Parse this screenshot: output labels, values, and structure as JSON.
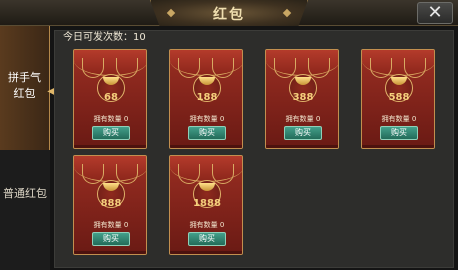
{
  "window": {
    "title": "红包",
    "close_symbol": "✕"
  },
  "sidebar": {
    "items": [
      {
        "label_line1": "拼手气",
        "label_line2": "红包",
        "active": true
      },
      {
        "label": "普通红包",
        "active": false
      }
    ]
  },
  "main": {
    "daily_count_label": "今日可发次数：10"
  },
  "cards": [
    {
      "amount": "68",
      "owned": "拥有数量 0",
      "buy": "购买"
    },
    {
      "amount": "188",
      "owned": "拥有数量 0",
      "buy": "购买"
    },
    {
      "amount": "388",
      "owned": "拥有数量 0",
      "buy": "购买"
    },
    {
      "amount": "588",
      "owned": "拥有数量 0",
      "buy": "购买"
    },
    {
      "amount": "888",
      "owned": "拥有数量 0",
      "buy": "购买"
    },
    {
      "amount": "1888",
      "owned": "拥有数量 0",
      "buy": "购买"
    }
  ],
  "colors": {
    "accent_gold": "#d8aa63",
    "card_red": "#9a2e22",
    "button_green": "#43a08b"
  }
}
